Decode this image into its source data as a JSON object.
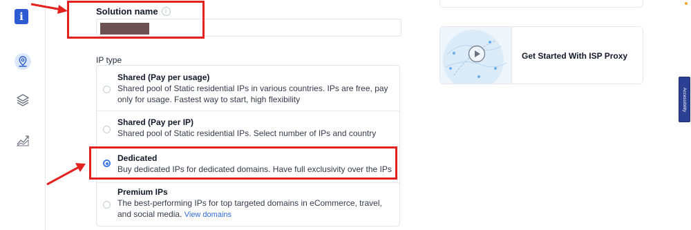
{
  "form": {
    "solution_name_label": "Solution name",
    "solution_name_info": "i",
    "ip_type_label": "IP type",
    "options": [
      {
        "title": "Shared (Pay per usage)",
        "description": "Shared pool of Static residential IPs in various countries. IPs are free, pay only for usage. Fastest way to start, high flexibility",
        "selected": false
      },
      {
        "title": "Shared (Pay per IP)",
        "description": "Shared pool of Static residential IPs. Select number of IPs and country",
        "selected": false
      },
      {
        "title": "Dedicated",
        "description": "Buy dedicated IPs for dedicated domains. Have full exclusivity over the IPs",
        "selected": true
      },
      {
        "title": "Premium IPs",
        "description": "The best-performing IPs for top targeted domains in eCommerce, travel, and social media.",
        "link": "View domains",
        "selected": false
      }
    ]
  },
  "sidebar": {
    "info_glyph": "i",
    "items": [
      "info-icon",
      "location-pin-icon",
      "layers-icon",
      "chart-trend-icon"
    ]
  },
  "video_card": {
    "title": "Get Started With ISP Proxy"
  },
  "accessibility_tab": "Accessibility",
  "colors": {
    "accent": "#2d5bd3",
    "radio_selected": "#3f7ae6",
    "callout_red": "#e3221f",
    "accessibility_tab": "#2b3f93"
  }
}
